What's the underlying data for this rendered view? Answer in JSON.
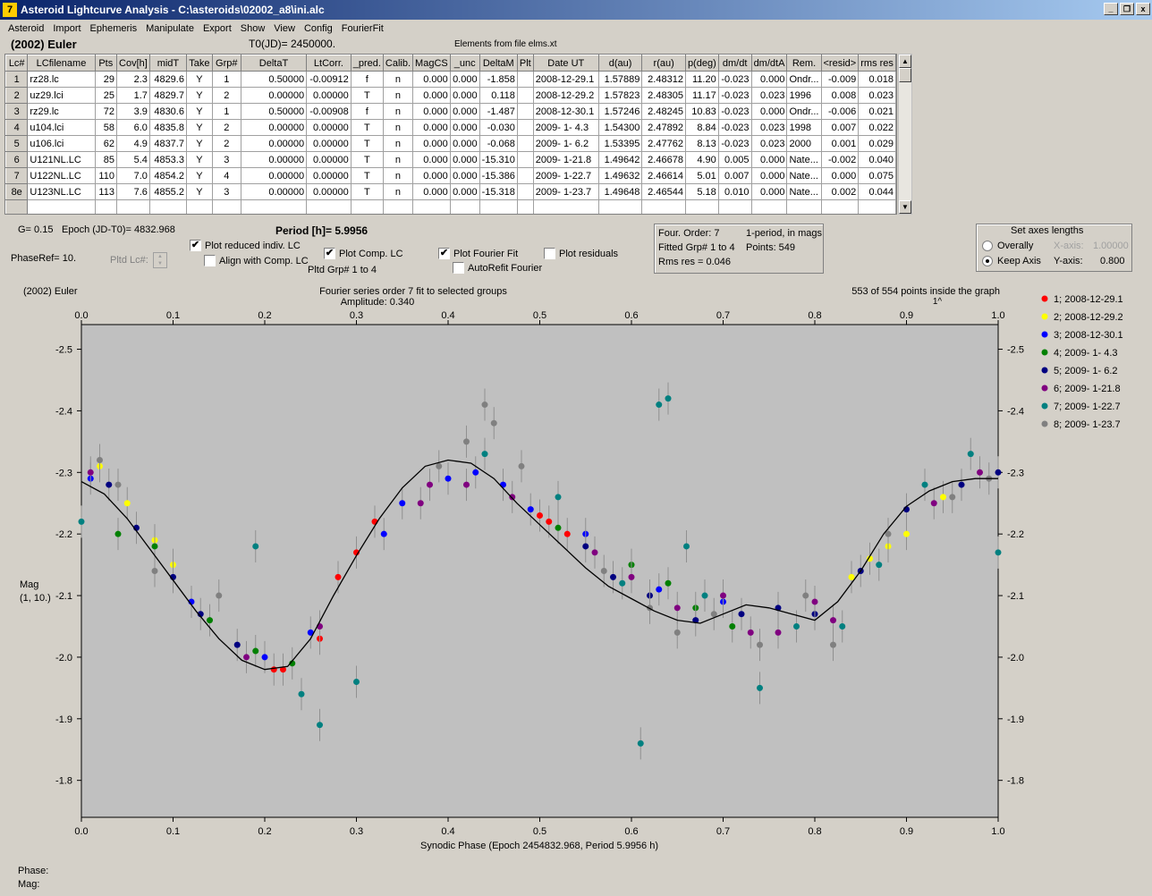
{
  "window": {
    "title": "Asteroid Lightcurve Analysis - C:\\asteroids\\02002_a8\\ini.alc",
    "minimize": "_",
    "restore": "❐",
    "close": "x"
  },
  "menu": [
    "Asteroid",
    "Import",
    "Ephemeris",
    "Manipulate",
    "Export",
    "Show",
    "View",
    "Config",
    "FourierFit"
  ],
  "header": {
    "asteroid": "(2002) Euler",
    "t0": "T0(JD)= 2450000.",
    "elements": "Elements from file elms.xt"
  },
  "table": {
    "columns": [
      "Lc#",
      "LCfilename",
      "Pts",
      "Cov[h]",
      "midT",
      "Take",
      "Grp#",
      "DeltaT",
      "LtCorr.",
      "_pred.",
      "Calib.",
      "MagCS",
      "_unc",
      "DeltaM",
      "Plt",
      "Date UT",
      "d(au)",
      "r(au)",
      "p(deg)",
      "dm/dt",
      "dm/dtA",
      "Rem.",
      "<resid>",
      "rms res"
    ],
    "rows": [
      [
        "1",
        "rz28.lc",
        "29",
        "2.3",
        "4829.6",
        "Y",
        "1",
        "0.50000",
        "-0.00912",
        "f",
        "n",
        "0.000",
        "0.000",
        "-1.858",
        "",
        "2008-12-29.1",
        "1.57889",
        "2.48312",
        "11.20",
        "-0.023",
        "0.000",
        "Ondr...",
        "-0.009",
        "0.018"
      ],
      [
        "2",
        "uz29.lci",
        "25",
        "1.7",
        "4829.7",
        "Y",
        "2",
        "0.00000",
        "0.00000",
        "T",
        "n",
        "0.000",
        "0.000",
        "0.118",
        "",
        "2008-12-29.2",
        "1.57823",
        "2.48305",
        "11.17",
        "-0.023",
        "0.023",
        "1996",
        "0.008",
        "0.023"
      ],
      [
        "3",
        "rz29.lc",
        "72",
        "3.9",
        "4830.6",
        "Y",
        "1",
        "0.50000",
        "-0.00908",
        "f",
        "n",
        "0.000",
        "0.000",
        "-1.487",
        "",
        "2008-12-30.1",
        "1.57246",
        "2.48245",
        "10.83",
        "-0.023",
        "0.000",
        "Ondr...",
        "-0.006",
        "0.021"
      ],
      [
        "4",
        "u104.lci",
        "58",
        "6.0",
        "4835.8",
        "Y",
        "2",
        "0.00000",
        "0.00000",
        "T",
        "n",
        "0.000",
        "0.000",
        "-0.030",
        "",
        "2009- 1- 4.3",
        "1.54300",
        "2.47892",
        "8.84",
        "-0.023",
        "0.023",
        "1998",
        "0.007",
        "0.022"
      ],
      [
        "5",
        "u106.lci",
        "62",
        "4.9",
        "4837.7",
        "Y",
        "2",
        "0.00000",
        "0.00000",
        "T",
        "n",
        "0.000",
        "0.000",
        "-0.068",
        "",
        "2009- 1- 6.2",
        "1.53395",
        "2.47762",
        "8.13",
        "-0.023",
        "0.023",
        "2000",
        "0.001",
        "0.029"
      ],
      [
        "6",
        "U121NL.LC",
        "85",
        "5.4",
        "4853.3",
        "Y",
        "3",
        "0.00000",
        "0.00000",
        "T",
        "n",
        "0.000",
        "0.000",
        "-15.310",
        "",
        "2009- 1-21.8",
        "1.49642",
        "2.46678",
        "4.90",
        "0.005",
        "0.000",
        "Nate...",
        "-0.002",
        "0.040"
      ],
      [
        "7",
        "U122NL.LC",
        "110",
        "7.0",
        "4854.2",
        "Y",
        "4",
        "0.00000",
        "0.00000",
        "T",
        "n",
        "0.000",
        "0.000",
        "-15.386",
        "",
        "2009- 1-22.7",
        "1.49632",
        "2.46614",
        "5.01",
        "0.007",
        "0.000",
        "Nate...",
        "0.000",
        "0.075"
      ],
      [
        "8e",
        "U123NL.LC",
        "113",
        "7.6",
        "4855.2",
        "Y",
        "3",
        "0.00000",
        "0.00000",
        "T",
        "n",
        "0.000",
        "0.000",
        "-15.318",
        "",
        "2009- 1-23.7",
        "1.49648",
        "2.46544",
        "5.18",
        "0.010",
        "0.000",
        "Nate...",
        "0.002",
        "0.044"
      ]
    ]
  },
  "controls": {
    "g": "G= 0.15",
    "epoch": "Epoch (JD-T0)= 4832.968",
    "period": "Period [h]= 5.9956",
    "phaseref": "PhaseRef= 10.",
    "pltd_lc": "Pltd Lc#:",
    "plot_reduced": "Plot reduced indiv. LC",
    "align": "Align with Comp. LC",
    "plot_comp": "Plot Comp. LC",
    "pltd_grp": "Pltd Grp#  1   to   4",
    "plot_fourier": "Plot Fourier Fit",
    "autorefit": "AutoRefit Fourier",
    "plot_residuals": "Plot residuals",
    "checked": "✔"
  },
  "fourier_box": {
    "order": "Four. Order:  7",
    "mode": "1-period, in mags",
    "fitted": "Fitted Grp# 1 to 4",
    "points": "Points: 549",
    "rms": "Rms res      = 0.046"
  },
  "axes_box": {
    "title": "Set axes lengths",
    "overally": "Overally",
    "keep": "Keep Axis",
    "xaxis_label": "X-axis:",
    "xaxis_value": "1.00000",
    "yaxis_label": "Y-axis:",
    "yaxis_value": "0.800"
  },
  "chart_data": {
    "type": "scatter",
    "title": "(2002) Euler",
    "subtitle": "Fourier series order 7 fit to selected groups",
    "amplitude": "Amplitude: 0.340",
    "points_note": "553 of 554 points inside the graph",
    "points_marker": "1^",
    "xlabel": "Synodic Phase (Epoch 2454832.968, Period 5.9956 h)",
    "ylabel": "Mag",
    "ylabel2": "(1, 10.)",
    "xlim": [
      0,
      1
    ],
    "ylim": [
      -1.74,
      -2.54
    ],
    "xticks": [
      "0.0",
      "0.1",
      "0.2",
      "0.3",
      "0.4",
      "0.5",
      "0.6",
      "0.7",
      "0.8",
      "0.9",
      "1.0"
    ],
    "yticks": [
      {
        "v": -2.5,
        "l": "-2.5"
      },
      {
        "v": -2.4,
        "l": "-2.4"
      },
      {
        "v": -2.3,
        "l": "-2.3"
      },
      {
        "v": -2.2,
        "l": "-2.2"
      },
      {
        "v": -2.1,
        "l": "-2.1"
      },
      {
        "v": -2.0,
        "l": "-2.0"
      },
      {
        "v": -1.9,
        "l": "-1.9"
      },
      {
        "v": -1.8,
        "l": "-1.8"
      }
    ],
    "grid": false,
    "legend_position": "right",
    "fit_curve": {
      "x": [
        0.0,
        0.025,
        0.05,
        0.075,
        0.1,
        0.125,
        0.15,
        0.175,
        0.2,
        0.225,
        0.25,
        0.275,
        0.3,
        0.325,
        0.35,
        0.375,
        0.4,
        0.425,
        0.45,
        0.475,
        0.5,
        0.525,
        0.55,
        0.575,
        0.6,
        0.625,
        0.65,
        0.675,
        0.7,
        0.725,
        0.75,
        0.775,
        0.8,
        0.825,
        0.85,
        0.875,
        0.9,
        0.925,
        0.95,
        0.975,
        1.0
      ],
      "y": [
        -2.285,
        -2.265,
        -2.225,
        -2.175,
        -2.125,
        -2.075,
        -2.03,
        -1.995,
        -1.98,
        -1.985,
        -2.03,
        -2.1,
        -2.165,
        -2.225,
        -2.275,
        -2.31,
        -2.32,
        -2.315,
        -2.29,
        -2.25,
        -2.215,
        -2.18,
        -2.145,
        -2.115,
        -2.095,
        -2.075,
        -2.06,
        -2.055,
        -2.07,
        -2.085,
        -2.08,
        -2.07,
        -2.06,
        -2.09,
        -2.14,
        -2.2,
        -2.245,
        -2.27,
        -2.285,
        -2.29,
        -2.29
      ]
    },
    "series": [
      {
        "name": "1; 2008-12-29.1",
        "color": "#ff0000",
        "x": [
          0.21,
          0.22,
          0.26,
          0.28,
          0.3,
          0.32,
          0.5,
          0.51,
          0.53
        ],
        "y": [
          -1.98,
          -1.98,
          -2.03,
          -2.13,
          -2.17,
          -2.22,
          -2.23,
          -2.22,
          -2.2
        ]
      },
      {
        "name": "2; 2008-12-29.2",
        "color": "#ffff00",
        "x": [
          0.02,
          0.05,
          0.08,
          0.1,
          0.84,
          0.86,
          0.88,
          0.9,
          0.94
        ],
        "y": [
          -2.31,
          -2.25,
          -2.19,
          -2.15,
          -2.13,
          -2.16,
          -2.18,
          -2.2,
          -2.26
        ]
      },
      {
        "name": "3; 2008-12-30.1",
        "color": "#0000ff",
        "x": [
          0.01,
          0.12,
          0.2,
          0.25,
          0.33,
          0.35,
          0.4,
          0.43,
          0.46,
          0.49,
          0.55,
          0.63,
          0.7
        ],
        "y": [
          -2.29,
          -2.09,
          -2.0,
          -2.04,
          -2.2,
          -2.25,
          -2.29,
          -2.3,
          -2.28,
          -2.24,
          -2.2,
          -2.11,
          -2.09
        ]
      },
      {
        "name": "4; 2009- 1- 4.3",
        "color": "#008000",
        "x": [
          0.04,
          0.08,
          0.14,
          0.19,
          0.23,
          0.52,
          0.6,
          0.64,
          0.67,
          0.71
        ],
        "y": [
          -2.2,
          -2.18,
          -2.06,
          -2.01,
          -1.99,
          -2.21,
          -2.15,
          -2.12,
          -2.08,
          -2.05
        ]
      },
      {
        "name": "5; 2009- 1- 6.2",
        "color": "#000080",
        "x": [
          0.03,
          0.06,
          0.1,
          0.13,
          0.17,
          0.55,
          0.58,
          0.62,
          0.67,
          0.72,
          0.76,
          0.8,
          0.85,
          0.9,
          0.96,
          1.0
        ],
        "y": [
          -2.28,
          -2.21,
          -2.13,
          -2.07,
          -2.02,
          -2.18,
          -2.13,
          -2.1,
          -2.06,
          -2.07,
          -2.08,
          -2.07,
          -2.14,
          -2.24,
          -2.28,
          -2.3
        ]
      },
      {
        "name": "6; 2009- 1-21.8",
        "color": "#800080",
        "x": [
          0.01,
          0.18,
          0.26,
          0.37,
          0.38,
          0.42,
          0.47,
          0.56,
          0.6,
          0.65,
          0.7,
          0.73,
          0.76,
          0.8,
          0.82,
          0.93,
          0.98
        ],
        "y": [
          -2.3,
          -2.0,
          -2.05,
          -2.25,
          -2.28,
          -2.28,
          -2.26,
          -2.17,
          -2.13,
          -2.08,
          -2.1,
          -2.04,
          -2.04,
          -2.09,
          -2.06,
          -2.25,
          -2.3
        ]
      },
      {
        "name": "7; 2009- 1-22.7",
        "color": "#008080",
        "x": [
          0.0,
          0.19,
          0.24,
          0.26,
          0.3,
          0.44,
          0.52,
          0.59,
          0.61,
          0.63,
          0.64,
          0.66,
          0.68,
          0.74,
          0.78,
          0.83,
          0.87,
          0.92,
          0.97,
          1.0
        ],
        "y": [
          -2.22,
          -2.18,
          -1.94,
          -1.89,
          -1.96,
          -2.33,
          -2.26,
          -2.12,
          -1.86,
          -2.41,
          -2.42,
          -2.18,
          -2.1,
          -1.95,
          -2.05,
          -2.05,
          -2.15,
          -2.28,
          -2.33,
          -2.17
        ]
      },
      {
        "name": "8; 2009- 1-23.7",
        "color": "#808080",
        "x": [
          0.02,
          0.04,
          0.08,
          0.15,
          0.39,
          0.42,
          0.44,
          0.45,
          0.48,
          0.57,
          0.62,
          0.65,
          0.69,
          0.74,
          0.79,
          0.82,
          0.88,
          0.95,
          0.99
        ],
        "y": [
          -2.32,
          -2.28,
          -2.14,
          -2.1,
          -2.31,
          -2.35,
          -2.41,
          -2.38,
          -2.31,
          -2.14,
          -2.08,
          -2.04,
          -2.07,
          -2.02,
          -2.1,
          -2.02,
          -2.2,
          -2.26,
          -2.29
        ]
      }
    ]
  },
  "status": {
    "phase": "Phase:",
    "mag": "Mag:"
  }
}
